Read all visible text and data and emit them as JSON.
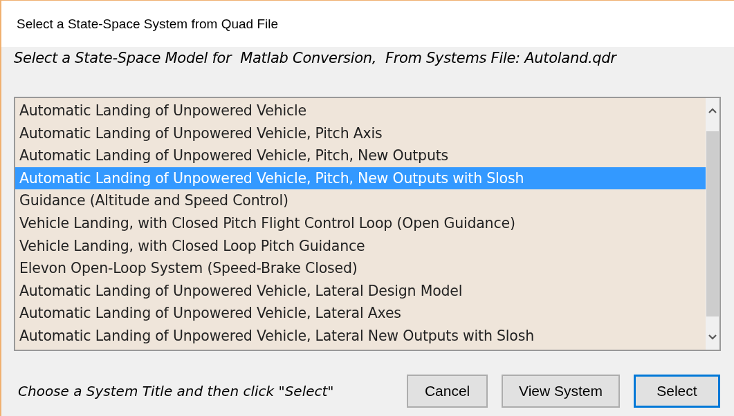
{
  "window": {
    "title": "Select a State-Space System from Quad File"
  },
  "heading": "Select a State-Space Model for  Matlab Conversion,  From Systems File: Autoland.qdr",
  "list": {
    "items": [
      {
        "label": "Automatic Landing of Unpowered Vehicle",
        "selected": false
      },
      {
        "label": "Automatic Landing of Unpowered Vehicle, Pitch Axis",
        "selected": false
      },
      {
        "label": "Automatic Landing of Unpowered Vehicle, Pitch, New Outputs",
        "selected": false
      },
      {
        "label": "Automatic Landing of Unpowered Vehicle, Pitch, New Outputs with Slosh",
        "selected": true
      },
      {
        "label": "Guidance (Altitude and Speed Control)",
        "selected": false
      },
      {
        "label": "Vehicle Landing, with Closed Pitch Flight Control Loop (Open Guidance)",
        "selected": false
      },
      {
        "label": "Vehicle Landing, with Closed Loop Pitch Guidance",
        "selected": false
      },
      {
        "label": "Elevon Open-Loop System (Speed-Brake Closed)",
        "selected": false
      },
      {
        "label": "Automatic Landing of Unpowered Vehicle, Lateral Design Model",
        "selected": false
      },
      {
        "label": "Automatic Landing of Unpowered Vehicle, Lateral Axes",
        "selected": false
      },
      {
        "label": "Automatic Landing of Unpowered Vehicle, Lateral New Outputs with Slosh",
        "selected": false
      }
    ]
  },
  "hint": "Choose a System Title and then click \"Select\"",
  "buttons": [
    {
      "label": "Cancel",
      "default": false
    },
    {
      "label": "View System",
      "default": false
    },
    {
      "label": "Select",
      "default": true
    }
  ]
}
